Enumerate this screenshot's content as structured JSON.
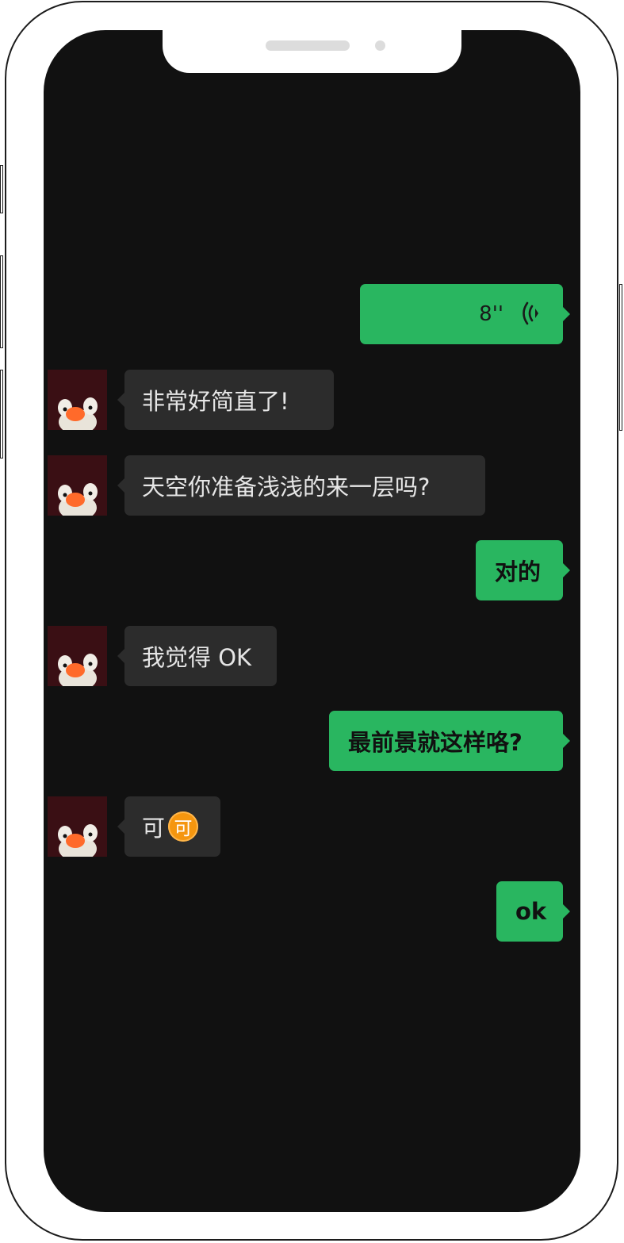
{
  "device": {
    "frame": "phone-notched"
  },
  "colors": {
    "screen_bg": "#111111",
    "incoming_bubble": "#2c2c2c",
    "outgoing_bubble": "#29b660",
    "incoming_text": "#e6e6e6",
    "outgoing_text": "#111111"
  },
  "chat": {
    "messages": [
      {
        "from": "me",
        "type": "voice",
        "duration": "8''",
        "icon": "voice-wave-icon"
      },
      {
        "from": "other",
        "type": "text",
        "text": "非常好简直了!"
      },
      {
        "from": "other",
        "type": "text",
        "text": "天空你准备浅浅的来一层吗?"
      },
      {
        "from": "me",
        "type": "text",
        "text": "对的"
      },
      {
        "from": "other",
        "type": "text",
        "text": "我觉得 OK"
      },
      {
        "from": "me",
        "type": "text",
        "text": "最前景就这样咯?"
      },
      {
        "from": "other",
        "type": "text",
        "text": "可",
        "emoji": "可",
        "emoji_icon": "ke-emoji-icon"
      },
      {
        "from": "me",
        "type": "text",
        "text": "ok"
      }
    ]
  }
}
